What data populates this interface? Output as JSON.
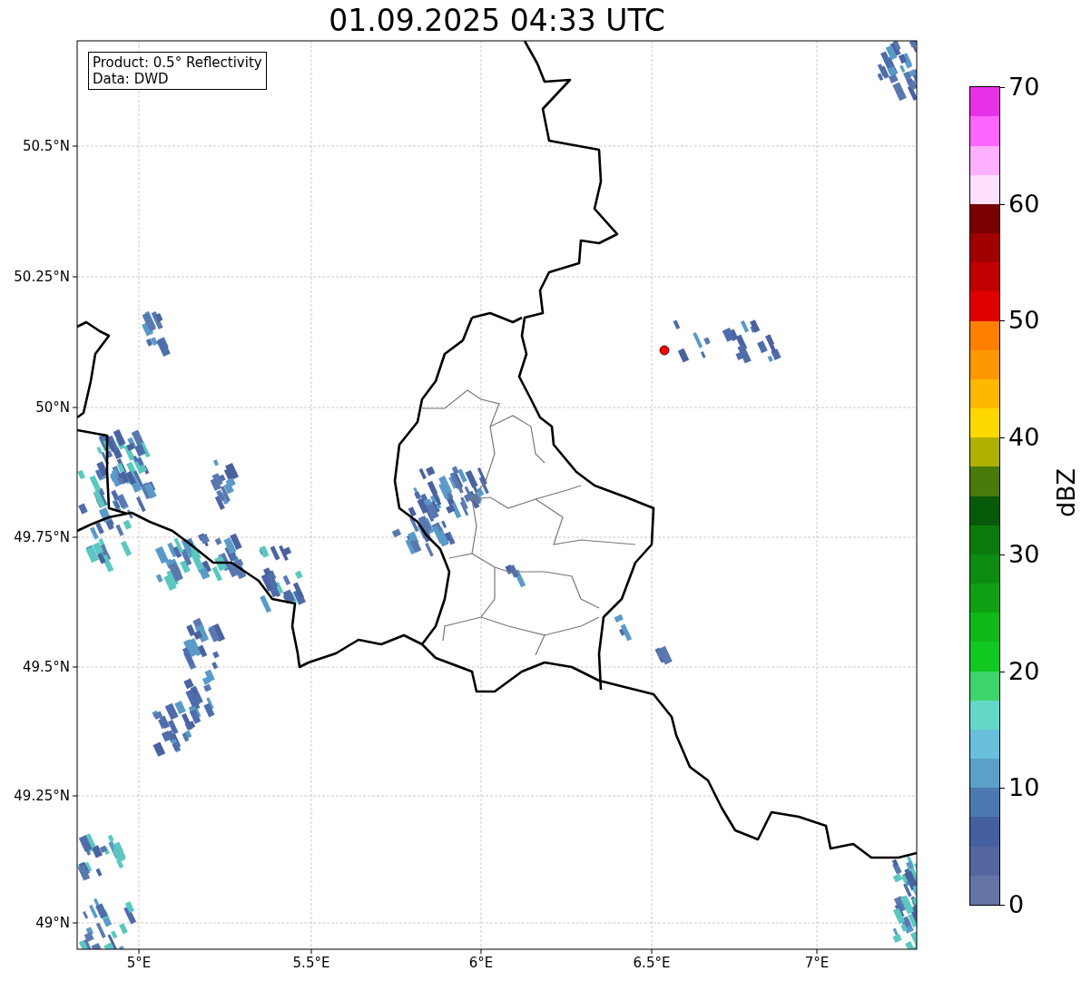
{
  "title": "01.09.2025 04:33 UTC",
  "map": {
    "info_box": [
      "Product: 0.5° Reflectivity",
      "Data: DWD"
    ],
    "x_ticks": [
      "5°E",
      "5.5°E",
      "6°E",
      "6.5°E",
      "7°E"
    ],
    "y_ticks": [
      "50.5°N",
      "50.25°N",
      "50°N",
      "49.75°N",
      "49.5°N",
      "49.25°N",
      "49°N"
    ]
  },
  "colorbar": {
    "label": "dBZ",
    "ticks": [
      "70",
      "60",
      "50",
      "40",
      "30",
      "20",
      "10",
      "0"
    ],
    "segments": [
      {
        "color": "#6474a6"
      },
      {
        "color": "#5565a0"
      },
      {
        "color": "#4560a0"
      },
      {
        "color": "#4a7ab0"
      },
      {
        "color": "#5aa0c8"
      },
      {
        "color": "#68c0dc"
      },
      {
        "color": "#64d8c8"
      },
      {
        "color": "#3dd46c"
      },
      {
        "color": "#10c820"
      },
      {
        "color": "#10b818"
      },
      {
        "color": "#10a014"
      },
      {
        "color": "#0c8c10"
      },
      {
        "color": "#0a7a0e"
      },
      {
        "color": "#065a0a"
      },
      {
        "color": "#4a7a0a"
      },
      {
        "color": "#b0b000"
      },
      {
        "color": "#ffd800"
      },
      {
        "color": "#ffb800"
      },
      {
        "color": "#ff9800"
      },
      {
        "color": "#ff8000"
      },
      {
        "color": "#e00000"
      },
      {
        "color": "#c00000"
      },
      {
        "color": "#a00000"
      },
      {
        "color": "#780000"
      },
      {
        "color": "#ffe0ff"
      },
      {
        "color": "#ffb0ff"
      },
      {
        "color": "#ff66ff"
      },
      {
        "color": "#e830e8"
      }
    ]
  }
}
